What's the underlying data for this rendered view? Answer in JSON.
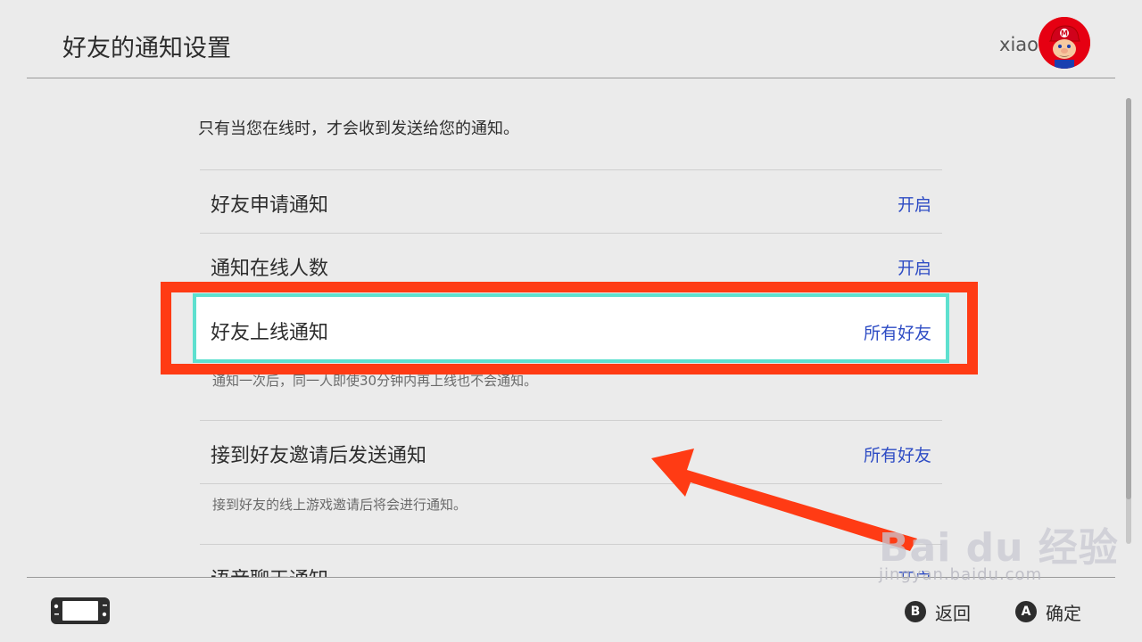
{
  "header": {
    "title": "好友的通知设置",
    "username": "xiao",
    "avatar_icon": "mario-avatar-icon"
  },
  "content": {
    "intro": "只有当您在线时，才会收到发送给您的通知。",
    "rows": [
      {
        "label": "好友申请通知",
        "value": "开启"
      },
      {
        "label": "通知在线人数",
        "value": "开启"
      },
      {
        "label": "好友上线通知",
        "value": "所有好友",
        "description": "通知一次后，同一人即使30分钟内再上线也不会通知。"
      },
      {
        "label": "接到好友邀请后发送通知",
        "value": "所有好友",
        "description": "接到好友的线上游戏邀请后将会进行通知。"
      },
      {
        "label": "语音聊天通知",
        "value": "开启"
      }
    ]
  },
  "footer": {
    "console_icon": "switch-console-icon",
    "back_key": "B",
    "back_label": "返回",
    "confirm_key": "A",
    "confirm_label": "确定"
  },
  "watermark": {
    "main": "Bai du 经验",
    "sub": "jingyan.baidu.com"
  },
  "colors": {
    "background": "#ebebeb",
    "value_text": "#2e4cc4",
    "focus_border": "#5ee0cf",
    "annotation": "#ff3b14"
  }
}
